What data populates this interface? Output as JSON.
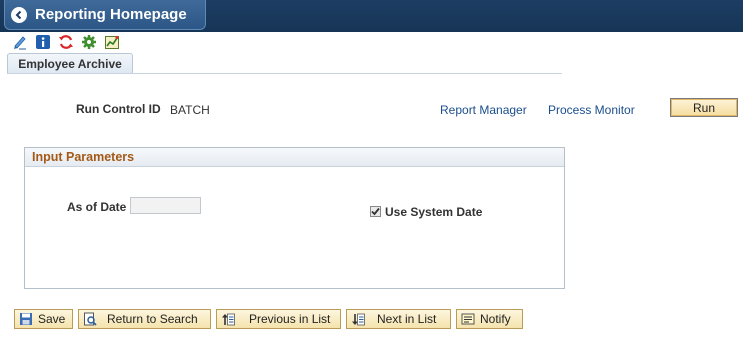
{
  "header": {
    "back_title": "Reporting Homepage"
  },
  "toolbar": {
    "icons": [
      "edit-pen-icon",
      "info-icon",
      "refresh-icon",
      "gear-icon",
      "chart-icon"
    ]
  },
  "tabs": [
    {
      "label": "Employee Archive"
    }
  ],
  "run_control": {
    "label": "Run Control ID",
    "value": "BATCH"
  },
  "links": {
    "report_manager": "Report Manager",
    "process_monitor": "Process Monitor"
  },
  "run_button": "Run",
  "input_parameters": {
    "title": "Input Parameters",
    "as_of_date_label": "As of Date",
    "as_of_date_value": "",
    "use_system_date_label": "Use System Date",
    "use_system_date_checked": true
  },
  "buttons": {
    "save": "Save",
    "return_to_search": "Return to Search",
    "previous_in_list": "Previous in List",
    "next_in_list": "Next in List",
    "notify": "Notify"
  },
  "colors": {
    "header_bg": "#1d3d63",
    "group_title": "#a45a16",
    "link": "#1b4e8c",
    "button_bg": "#f5e3ad"
  }
}
